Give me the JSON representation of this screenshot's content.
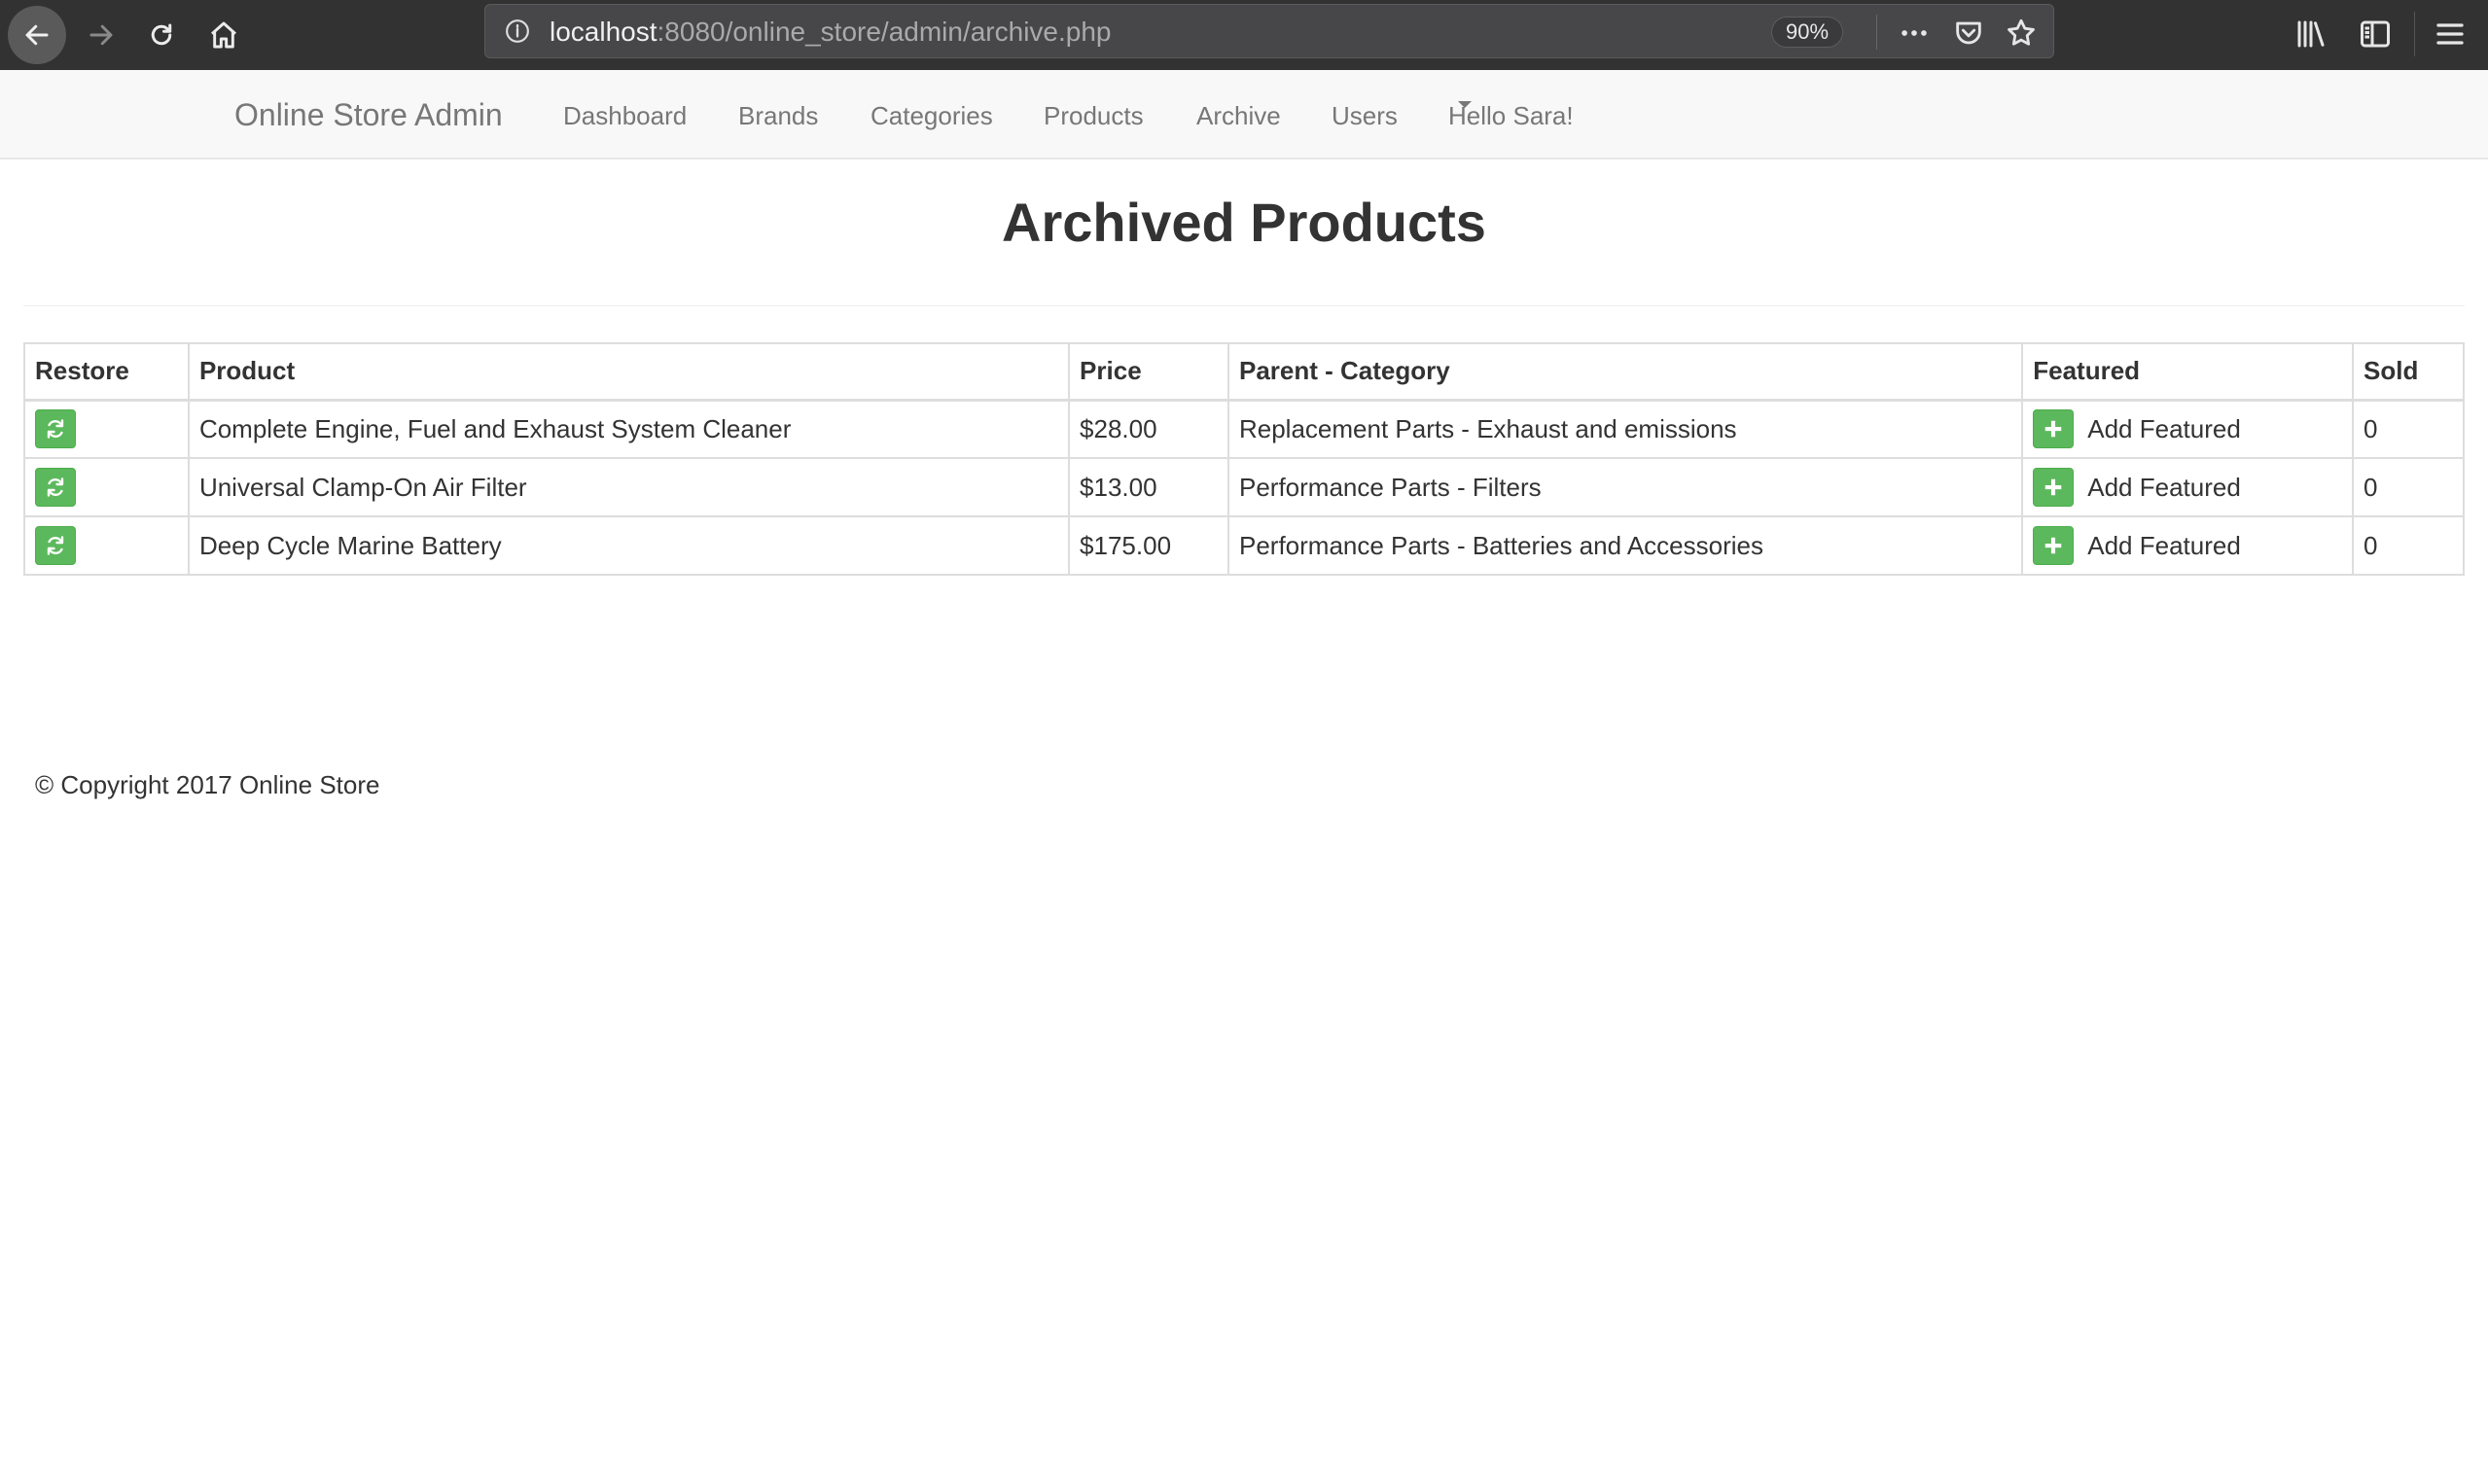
{
  "browser": {
    "url_host": "localhost",
    "url_rest": ":8080/online_store/admin/archive.php",
    "zoom": "90%"
  },
  "navbar": {
    "brand": "Online Store Admin",
    "links": [
      "Dashboard",
      "Brands",
      "Categories",
      "Products",
      "Archive",
      "Users"
    ],
    "user_menu": "Hello Sara!"
  },
  "page": {
    "title": "Archived Products"
  },
  "table": {
    "headers": [
      "Restore",
      "Product",
      "Price",
      "Parent - Category",
      "Featured",
      "Sold"
    ],
    "rows": [
      {
        "product": "Complete Engine, Fuel and Exhaust System Cleaner",
        "price": "$28.00",
        "category": "Replacement Parts - Exhaust and emissions",
        "featured": "Add Featured",
        "sold": "0"
      },
      {
        "product": "Universal Clamp-On Air Filter",
        "price": "$13.00",
        "category": "Performance Parts - Filters",
        "featured": "Add Featured",
        "sold": "0"
      },
      {
        "product": "Deep Cycle Marine Battery",
        "price": "$175.00",
        "category": "Performance Parts - Batteries and Accessories",
        "featured": "Add Featured",
        "sold": "0"
      }
    ]
  },
  "footer": {
    "copyright": "© Copyright 2017 Online Store"
  },
  "colors": {
    "success_green": "#5cb85c",
    "navbar_bg": "#f8f8f8",
    "chrome_bg": "#323232"
  },
  "icons": {
    "restore": "refresh-icon",
    "featured": "plus-icon"
  }
}
